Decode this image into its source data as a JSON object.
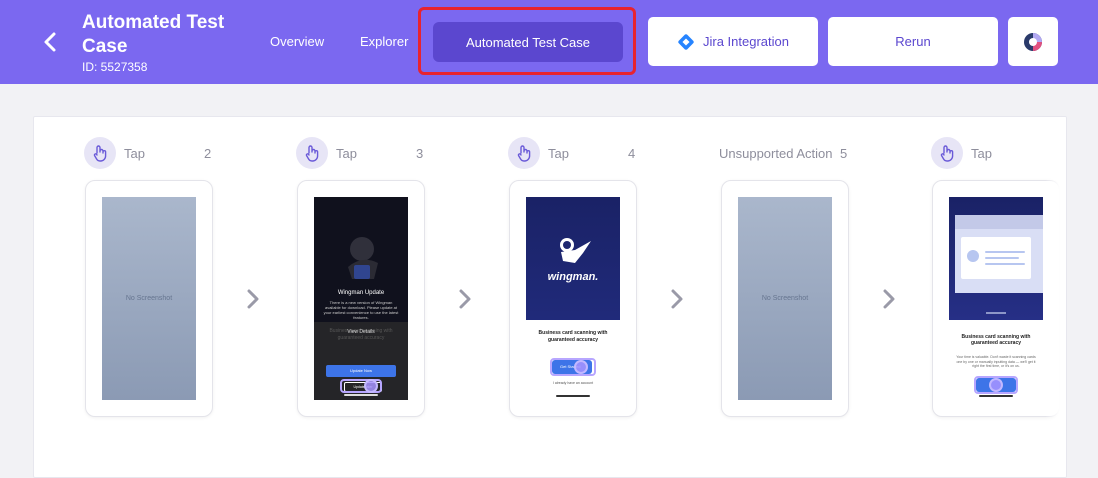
{
  "header": {
    "title": "Automated Test Case",
    "subtitle": "ID: 5527358",
    "nav": {
      "overview": "Overview",
      "explorer": "Explorer",
      "active_tab": "Automated Test Case"
    },
    "buttons": {
      "jira": "Jira Integration",
      "rerun": "Rerun"
    },
    "colors": {
      "header_bg": "#7b68f0",
      "active_tab_bg": "#5b47cf",
      "highlight_outline": "#e8232f",
      "button_text": "#5b47cf"
    }
  },
  "steps": [
    {
      "label": "Tap",
      "number": "2",
      "screenshot": "No Screenshot"
    },
    {
      "label": "Tap",
      "number": "3",
      "screen": {
        "title": "Wingman Update",
        "text": "There is a new version of Wingman available for download. Please update at your earliest convenience to use the latest features.",
        "view_details": "View Details",
        "background_text": "Business card scanning with guaranteed accuracy",
        "update_now": "Update Now",
        "update_later": "Update later"
      }
    },
    {
      "label": "Tap",
      "number": "4",
      "screen": {
        "wordmark": "wingman.",
        "headline": "Business card scanning with guaranteed accuracy",
        "cta": "Get Started",
        "secondary": "I already have an account"
      }
    },
    {
      "label": "Unsupported Action",
      "number": "5",
      "screenshot": "No Screenshot"
    },
    {
      "label": "Tap",
      "number": "",
      "screen": {
        "headline": "Business card scanning with guaranteed accuracy",
        "body": "Your time is valuable. Don't waste it scanning cards one by one or manually inputting data — we'll get it right the first time, or it's on us."
      }
    }
  ]
}
